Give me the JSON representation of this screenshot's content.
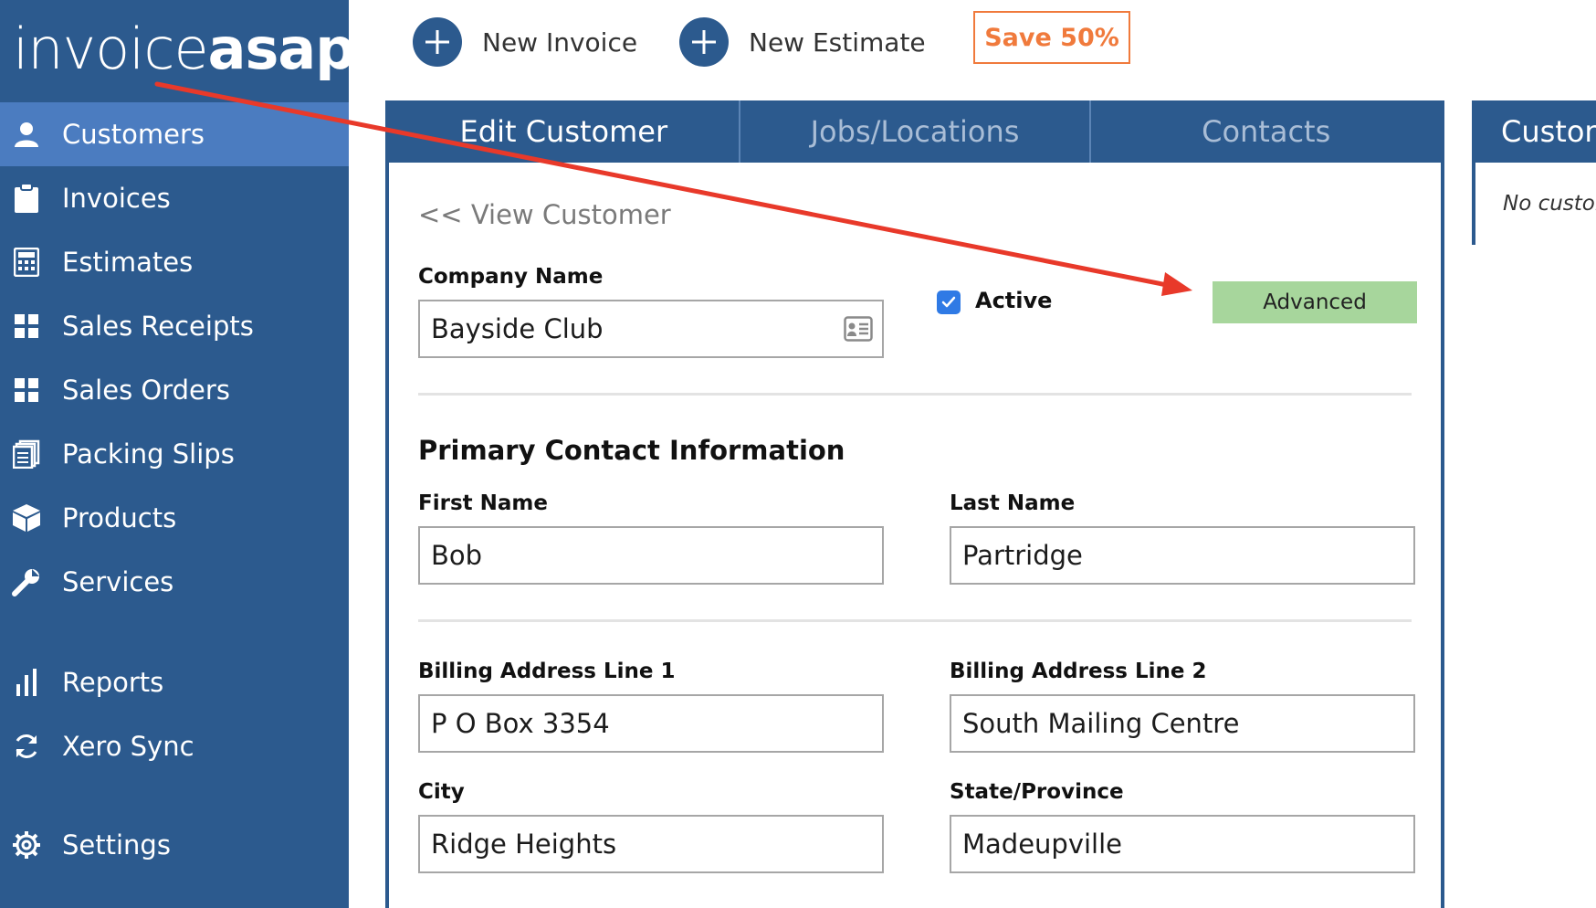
{
  "sidebar": {
    "logo_thin": "invoice",
    "logo_bold": "asap",
    "items": [
      {
        "label": "Customers",
        "icon": "user-icon"
      },
      {
        "label": "Invoices",
        "icon": "clipboard-icon"
      },
      {
        "label": "Estimates",
        "icon": "calculator-icon"
      },
      {
        "label": "Sales Receipts",
        "icon": "grid-icon"
      },
      {
        "label": "Sales Orders",
        "icon": "grid-icon"
      },
      {
        "label": "Packing Slips",
        "icon": "stack-icon"
      },
      {
        "label": "Products",
        "icon": "box-icon"
      },
      {
        "label": "Services",
        "icon": "wrench-icon"
      },
      {
        "label": "Reports",
        "icon": "bar-chart-icon"
      },
      {
        "label": "Xero Sync",
        "icon": "sync-icon"
      },
      {
        "label": "Settings",
        "icon": "gear-icon"
      }
    ]
  },
  "toolbar": {
    "new_invoice": "New Invoice",
    "new_estimate": "New Estimate",
    "save": "Save 50%"
  },
  "tabs": [
    "Edit Customer",
    "Jobs/Locations",
    "Contacts"
  ],
  "form": {
    "back_link": "<<  View Customer",
    "company_name_label": "Company Name",
    "company_name_value": "Bayside Club",
    "active_label": "Active",
    "active_checked": true,
    "advanced_button": "Advanced",
    "section_title": "Primary Contact Information",
    "first_name_label": "First Name",
    "first_name_value": "Bob",
    "last_name_label": "Last Name",
    "last_name_value": "Partridge",
    "billing1_label": "Billing Address Line 1",
    "billing1_value": "P O Box 3354",
    "billing2_label": "Billing Address Line 2",
    "billing2_value": "South Mailing Centre",
    "city_label": "City",
    "city_value": "Ridge Heights",
    "state_label": "State/Province",
    "state_value": "Madeupville"
  },
  "right_panel": {
    "header": "Custon",
    "text": "No custor"
  },
  "colors": {
    "sidebar": "#2c5a8e",
    "sidebar_active": "#4b7cc0",
    "save_orange": "#f07a3c",
    "advanced_green": "#a7d69c",
    "annotation_arrow": "#e8392a"
  }
}
